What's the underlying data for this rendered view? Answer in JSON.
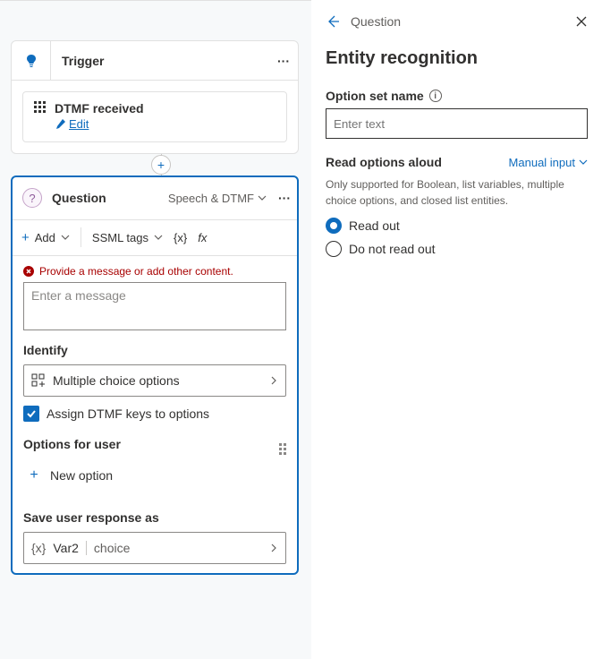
{
  "trigger": {
    "title": "Trigger",
    "event_title": "DTMF received",
    "edit_label": "Edit"
  },
  "question": {
    "title": "Question",
    "mode": "Speech & DTMF",
    "toolbar": {
      "add": "Add",
      "ssml": "SSML tags",
      "var": "{x}",
      "fx": "fx"
    },
    "error": "Provide a message or add other content.",
    "message_placeholder": "Enter a message",
    "identify_label": "Identify",
    "identify_value": "Multiple choice options",
    "assign_label": "Assign DTMF keys to options",
    "options_label": "Options for user",
    "new_option_label": "New option",
    "save_label": "Save user response as",
    "var_name": "Var2",
    "var_type": "choice",
    "var_token": "{x}"
  },
  "panel": {
    "breadcrumb": "Question",
    "title": "Entity recognition",
    "option_set_label": "Option set name",
    "option_set_placeholder": "Enter text",
    "read_label": "Read options aloud",
    "read_mode": "Manual input",
    "help": "Only supported for Boolean, list variables, multiple choice options, and closed list entities.",
    "radio1": "Read out",
    "radio2": "Do not read out"
  }
}
